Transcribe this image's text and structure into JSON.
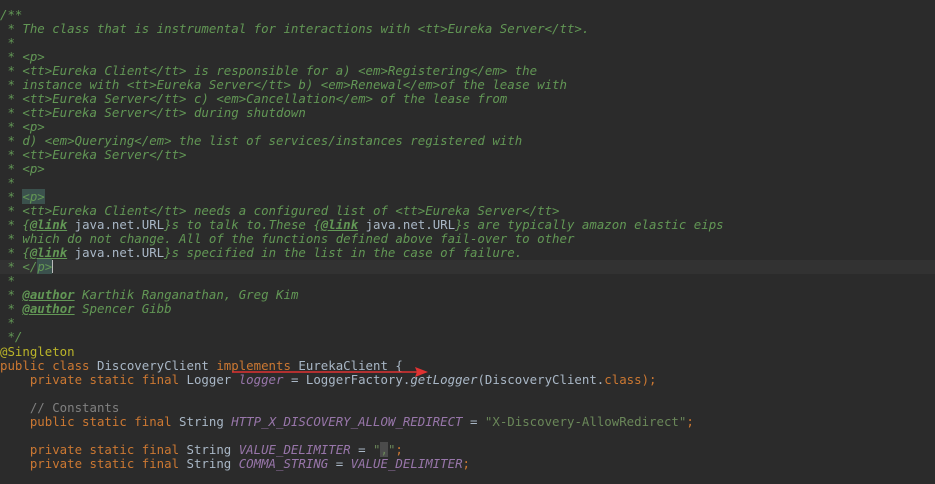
{
  "theme": {
    "background": "#2b2b2b",
    "doc_comment": "#629755",
    "keyword": "#cc7832",
    "annotation": "#bbb529",
    "field": "#9876aa",
    "string": "#6a8759",
    "line_comment": "#808080",
    "plain": "#a9b7c6",
    "arrow": "#e03232"
  },
  "code": {
    "l1": "/**",
    "l2": " * The class that is instrumental for interactions with <tt>Eureka Server</tt>.",
    "l3": " *",
    "l4": " * <p>",
    "l5": " * <tt>Eureka Client</tt> is responsible for a) <em>Registering</em> the",
    "l6": " * instance with <tt>Eureka Server</tt> b) <em>Renewal</em>of the lease with",
    "l7": " * <tt>Eureka Server</tt> c) <em>Cancellation</em> of the lease from",
    "l8": " * <tt>Eureka Server</tt> during shutdown",
    "l9": " * <p>",
    "l10": " * d) <em>Querying</em> the list of services/instances registered with",
    "l11": " * <tt>Eureka Server</tt>",
    "l12": " * <p>",
    "l13": " *",
    "l14a": " * ",
    "l14b": "<p>",
    "l15": " * <tt>Eureka Client</tt> needs a configured list of <tt>Eureka Server</tt>",
    "l16a": " * {",
    "l16b": "@link",
    "l16c": " java.net.URL",
    "l16d": "}s to talk to.These {",
    "l16e": "@link",
    "l16f": " java.net.URL",
    "l16g": "}s are typically amazon elastic eips",
    "l17": " * which do not change. All of the functions defined above fail-over to other",
    "l18a": " * {",
    "l18b": "@link",
    "l18c": " java.net.URL",
    "l18d": "}s specified in the list in the case of failure.",
    "l19a": " * </",
    "l19b": "p>",
    "l20": " *",
    "l21a": " * ",
    "l21b": "@author",
    "l21c": " Karthik Ranganathan, Greg Kim",
    "l22a": " * ",
    "l22b": "@author",
    "l22c": " Spencer Gibb",
    "l23": " *",
    "l24": " */",
    "l25": "@Singleton",
    "l26a": "public class ",
    "l26b": "DiscoveryClient ",
    "l26c": "implements ",
    "l26d": "EurekaClient {",
    "l27a": "    private static final ",
    "l27b": "Logger ",
    "l27c": "logger",
    "l27d": " = LoggerFactory.",
    "l27e": "getLogger",
    "l27f": "(DiscoveryClient.",
    "l27g": "class",
    "l27h": ");",
    "l28": "",
    "l29": "    // Constants",
    "l30a": "    public static final ",
    "l30b": "String ",
    "l30c": "HTTP_X_DISCOVERY_ALLOW_REDIRECT",
    "l30d": " = ",
    "l30e": "\"X-Discovery-AllowRedirect\"",
    "l30f": ";",
    "l31": "",
    "l32a": "    private static final ",
    "l32b": "String ",
    "l32c": "VALUE_DELIMITER",
    "l32d": " = ",
    "l32e": "\"",
    "l32f": ",",
    "l32g": "\"",
    "l32h": ";",
    "l33a": "    private static final ",
    "l33b": "String ",
    "l33c": "COMMA_STRING",
    "l33d": " = ",
    "l33e": "VALUE_DELIMITER",
    "l33f": ";"
  }
}
